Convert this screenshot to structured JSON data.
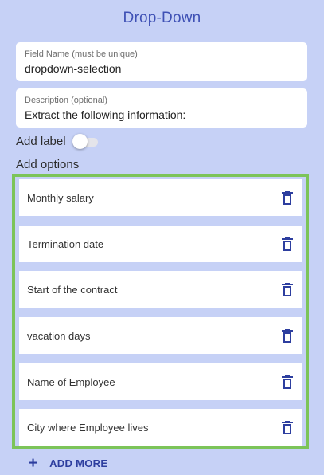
{
  "title": "Drop-Down",
  "field_name": {
    "label": "Field Name (must be unique)",
    "value": "dropdown-selection"
  },
  "description": {
    "label": "Description (optional)",
    "value": "Extract the following information:"
  },
  "add_label": {
    "label": "Add label",
    "enabled": false
  },
  "options_heading": "Add options",
  "options": [
    {
      "label": "Monthly salary"
    },
    {
      "label": "Termination date"
    },
    {
      "label": "Start of the contract"
    },
    {
      "label": "vacation days"
    },
    {
      "label": "Name of Employee"
    },
    {
      "label": "City where Employee lives"
    }
  ],
  "add_more": {
    "icon": "+",
    "label": "ADD MORE"
  },
  "colors": {
    "background": "#c6d1f6",
    "title": "#3f51b5",
    "highlight_border": "#7cc459",
    "icon": "#2d3e9f"
  }
}
